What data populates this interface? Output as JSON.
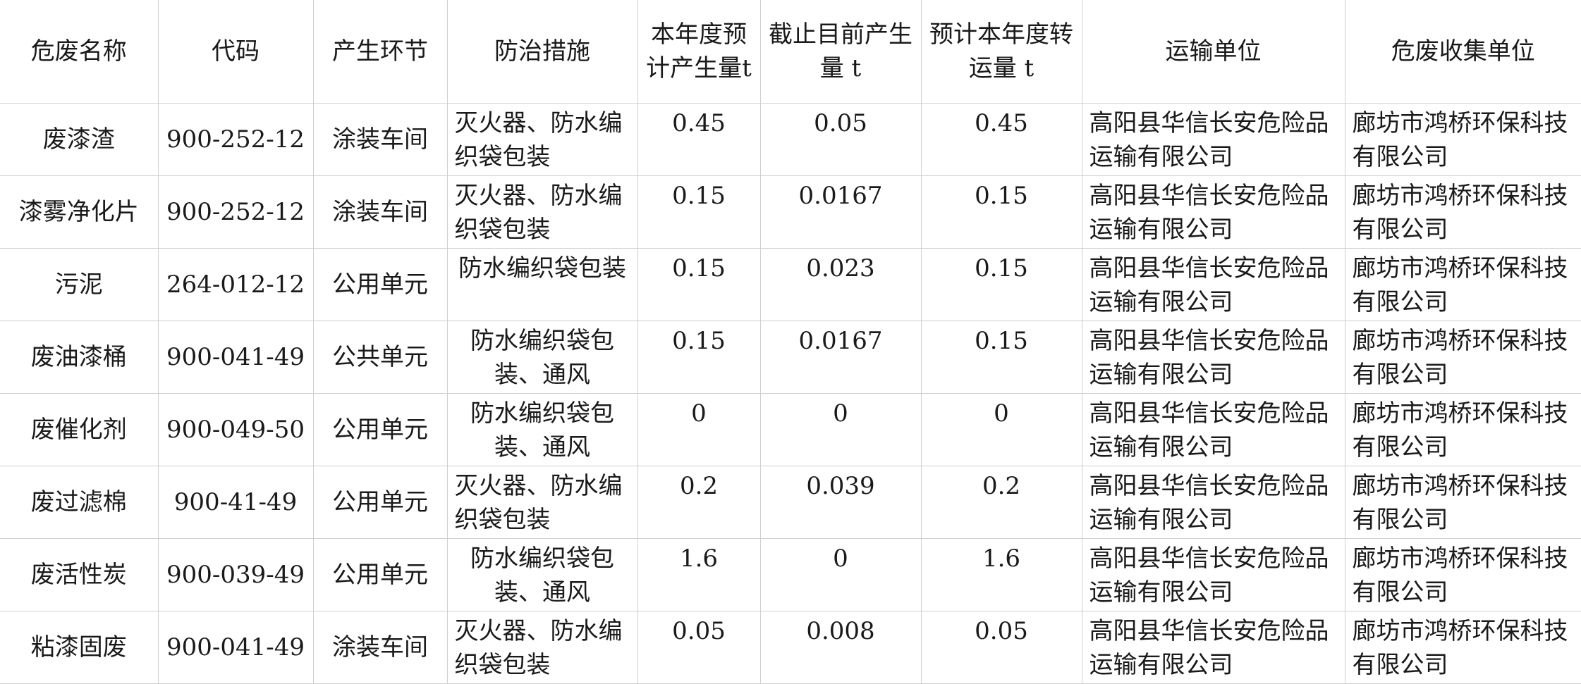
{
  "table": {
    "headers": [
      "危废名称",
      "代码",
      "产生环节",
      "防治措施",
      "本年度预计产生量t",
      "截止目前产生量 t",
      "预计本年度转运量 t",
      "运输单位",
      "危废收集单位"
    ],
    "rows": [
      [
        "废漆渣",
        "900-252-12",
        "涂装车间",
        "灭火器、防水编织袋包装",
        "0.45",
        "0.05",
        "0.45",
        "高阳县华信长安危险品运输有限公司",
        "廊坊市鸿桥环保科技有限公司"
      ],
      [
        "漆雾净化片",
        "900-252-12",
        "涂装车间",
        "灭火器、防水编织袋包装",
        "0.15",
        "0.0167",
        "0.15",
        "高阳县华信长安危险品运输有限公司",
        "廊坊市鸿桥环保科技有限公司"
      ],
      [
        "污泥",
        "264-012-12",
        "公用单元",
        "防水编织袋包装",
        "0.15",
        "0.023",
        "0.15",
        "高阳县华信长安危险品运输有限公司",
        "廊坊市鸿桥环保科技有限公司"
      ],
      [
        "废油漆桶",
        "900-041-49",
        "公共单元",
        "防水编织袋包装、通风",
        "0.15",
        "0.0167",
        "0.15",
        "高阳县华信长安危险品运输有限公司",
        "廊坊市鸿桥环保科技有限公司"
      ],
      [
        "废催化剂",
        "900-049-50",
        "公用单元",
        "防水编织袋包装、通风",
        "0",
        "0",
        "0",
        "高阳县华信长安危险品运输有限公司",
        "廊坊市鸿桥环保科技有限公司"
      ],
      [
        "废过滤棉",
        "900-41-49",
        "公用单元",
        "灭火器、防水编织袋包装",
        "0.2",
        "0.039",
        "0.2",
        "高阳县华信长安危险品运输有限公司",
        "廊坊市鸿桥环保科技有限公司"
      ],
      [
        "废活性炭",
        "900-039-49",
        "公用单元",
        "防水编织袋包装、通风",
        "1.6",
        "0",
        "1.6",
        "高阳县华信长安危险品运输有限公司",
        "廊坊市鸿桥环保科技有限公司"
      ],
      [
        "粘漆固废",
        "900-041-49",
        "涂装车间",
        "灭火器、防水编织袋包装",
        "0.05",
        "0.008",
        "0.05",
        "高阳县华信长安危险品运输有限公司",
        "廊坊市鸿桥环保科技有限公司"
      ]
    ]
  }
}
